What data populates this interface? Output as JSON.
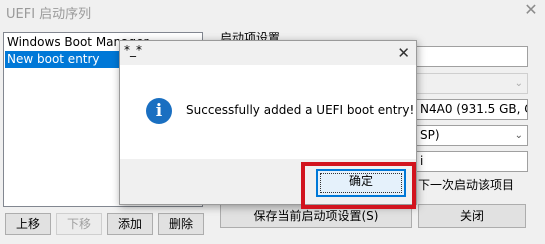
{
  "window": {
    "title": "UEFI 启动序列",
    "close_glyph": "✕"
  },
  "boot_list": [
    {
      "label": "Windows Boot Manager",
      "selected": false
    },
    {
      "label": "New boot entry",
      "selected": true
    }
  ],
  "settings": {
    "group_label": "启动项设置",
    "disk_value": "N4A0 (931.5 GB, C",
    "partition_value": "SP)",
    "path_value": "i",
    "next_boot_label": "下一次启动该项目",
    "dropdown_glyph": "⌄"
  },
  "buttons": {
    "move_up": "上移",
    "move_down": "下移",
    "add": "添加",
    "delete": "删除",
    "save": "保存当前启动项设置(S)",
    "close": "关闭"
  },
  "dialog": {
    "title": "*_*",
    "close_glyph": "✕",
    "icon": "info-icon",
    "icon_glyph": "i",
    "message": "Successfully added a UEFI boot entry!",
    "ok_label": "确定"
  },
  "colors": {
    "selection": "#0078d7",
    "highlight": "#d2141e",
    "info_icon": "#1a6fc1"
  }
}
